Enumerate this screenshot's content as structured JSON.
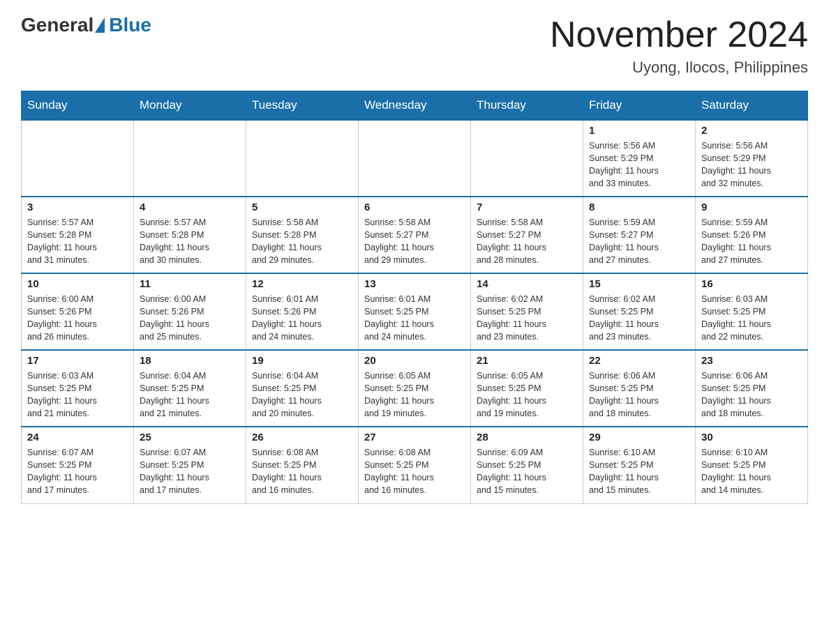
{
  "header": {
    "logo_general": "General",
    "logo_blue": "Blue",
    "month_title": "November 2024",
    "location": "Uyong, Ilocos, Philippines"
  },
  "days_of_week": [
    "Sunday",
    "Monday",
    "Tuesday",
    "Wednesday",
    "Thursday",
    "Friday",
    "Saturday"
  ],
  "weeks": [
    {
      "days": [
        {
          "num": "",
          "info": "",
          "empty": true
        },
        {
          "num": "",
          "info": "",
          "empty": true
        },
        {
          "num": "",
          "info": "",
          "empty": true
        },
        {
          "num": "",
          "info": "",
          "empty": true
        },
        {
          "num": "",
          "info": "",
          "empty": true
        },
        {
          "num": "1",
          "info": "Sunrise: 5:56 AM\nSunset: 5:29 PM\nDaylight: 11 hours\nand 33 minutes."
        },
        {
          "num": "2",
          "info": "Sunrise: 5:56 AM\nSunset: 5:29 PM\nDaylight: 11 hours\nand 32 minutes."
        }
      ]
    },
    {
      "days": [
        {
          "num": "3",
          "info": "Sunrise: 5:57 AM\nSunset: 5:28 PM\nDaylight: 11 hours\nand 31 minutes."
        },
        {
          "num": "4",
          "info": "Sunrise: 5:57 AM\nSunset: 5:28 PM\nDaylight: 11 hours\nand 30 minutes."
        },
        {
          "num": "5",
          "info": "Sunrise: 5:58 AM\nSunset: 5:28 PM\nDaylight: 11 hours\nand 29 minutes."
        },
        {
          "num": "6",
          "info": "Sunrise: 5:58 AM\nSunset: 5:27 PM\nDaylight: 11 hours\nand 29 minutes."
        },
        {
          "num": "7",
          "info": "Sunrise: 5:58 AM\nSunset: 5:27 PM\nDaylight: 11 hours\nand 28 minutes."
        },
        {
          "num": "8",
          "info": "Sunrise: 5:59 AM\nSunset: 5:27 PM\nDaylight: 11 hours\nand 27 minutes."
        },
        {
          "num": "9",
          "info": "Sunrise: 5:59 AM\nSunset: 5:26 PM\nDaylight: 11 hours\nand 27 minutes."
        }
      ]
    },
    {
      "days": [
        {
          "num": "10",
          "info": "Sunrise: 6:00 AM\nSunset: 5:26 PM\nDaylight: 11 hours\nand 26 minutes."
        },
        {
          "num": "11",
          "info": "Sunrise: 6:00 AM\nSunset: 5:26 PM\nDaylight: 11 hours\nand 25 minutes."
        },
        {
          "num": "12",
          "info": "Sunrise: 6:01 AM\nSunset: 5:26 PM\nDaylight: 11 hours\nand 24 minutes."
        },
        {
          "num": "13",
          "info": "Sunrise: 6:01 AM\nSunset: 5:25 PM\nDaylight: 11 hours\nand 24 minutes."
        },
        {
          "num": "14",
          "info": "Sunrise: 6:02 AM\nSunset: 5:25 PM\nDaylight: 11 hours\nand 23 minutes."
        },
        {
          "num": "15",
          "info": "Sunrise: 6:02 AM\nSunset: 5:25 PM\nDaylight: 11 hours\nand 23 minutes."
        },
        {
          "num": "16",
          "info": "Sunrise: 6:03 AM\nSunset: 5:25 PM\nDaylight: 11 hours\nand 22 minutes."
        }
      ]
    },
    {
      "days": [
        {
          "num": "17",
          "info": "Sunrise: 6:03 AM\nSunset: 5:25 PM\nDaylight: 11 hours\nand 21 minutes."
        },
        {
          "num": "18",
          "info": "Sunrise: 6:04 AM\nSunset: 5:25 PM\nDaylight: 11 hours\nand 21 minutes."
        },
        {
          "num": "19",
          "info": "Sunrise: 6:04 AM\nSunset: 5:25 PM\nDaylight: 11 hours\nand 20 minutes."
        },
        {
          "num": "20",
          "info": "Sunrise: 6:05 AM\nSunset: 5:25 PM\nDaylight: 11 hours\nand 19 minutes."
        },
        {
          "num": "21",
          "info": "Sunrise: 6:05 AM\nSunset: 5:25 PM\nDaylight: 11 hours\nand 19 minutes."
        },
        {
          "num": "22",
          "info": "Sunrise: 6:06 AM\nSunset: 5:25 PM\nDaylight: 11 hours\nand 18 minutes."
        },
        {
          "num": "23",
          "info": "Sunrise: 6:06 AM\nSunset: 5:25 PM\nDaylight: 11 hours\nand 18 minutes."
        }
      ]
    },
    {
      "days": [
        {
          "num": "24",
          "info": "Sunrise: 6:07 AM\nSunset: 5:25 PM\nDaylight: 11 hours\nand 17 minutes."
        },
        {
          "num": "25",
          "info": "Sunrise: 6:07 AM\nSunset: 5:25 PM\nDaylight: 11 hours\nand 17 minutes."
        },
        {
          "num": "26",
          "info": "Sunrise: 6:08 AM\nSunset: 5:25 PM\nDaylight: 11 hours\nand 16 minutes."
        },
        {
          "num": "27",
          "info": "Sunrise: 6:08 AM\nSunset: 5:25 PM\nDaylight: 11 hours\nand 16 minutes."
        },
        {
          "num": "28",
          "info": "Sunrise: 6:09 AM\nSunset: 5:25 PM\nDaylight: 11 hours\nand 15 minutes."
        },
        {
          "num": "29",
          "info": "Sunrise: 6:10 AM\nSunset: 5:25 PM\nDaylight: 11 hours\nand 15 minutes."
        },
        {
          "num": "30",
          "info": "Sunrise: 6:10 AM\nSunset: 5:25 PM\nDaylight: 11 hours\nand 14 minutes."
        }
      ]
    }
  ]
}
